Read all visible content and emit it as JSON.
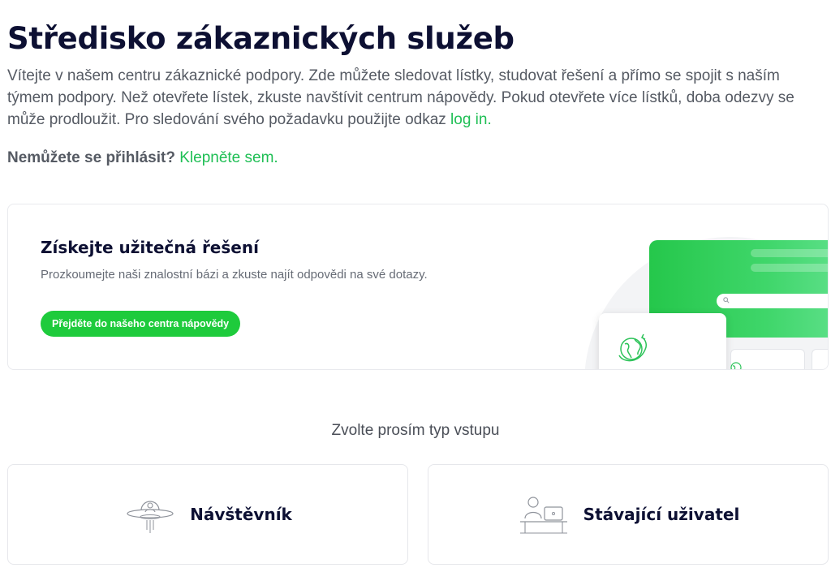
{
  "header": {
    "title": "Středisko zákaznických služeb",
    "intro_text": "Vítejte v našem centru zákaznické podpory. Zde můžete sledovat lístky, studovat řešení a přímo se spojit s naším týmem podpory. Než otevřete lístek, zkuste navštívit centrum nápovědy. Pokud otevřete více lístků, doba odezvy se může prodloužit. Pro sledování svého požadavku použijte odkaz ",
    "login_link": "log in.",
    "cant_login_label": "Nemůžete se přihlásit?",
    "click_here_link": "Klepněte sem."
  },
  "solutions": {
    "title": "Získejte užitečná řešení",
    "description": "Prozkoumejte naši znalostní bázi a zkuste najít odpovědi na své dotazy.",
    "button_label": "Přejděte do našeho centra nápovědy",
    "illustration_icons": [
      "search-icon",
      "globe-icon"
    ]
  },
  "entry_type": {
    "prompt": "Zvolte prosím typ vstupu",
    "options": [
      {
        "label": "Návštěvník",
        "icon": "ufo-visitor-icon"
      },
      {
        "label": "Stávající uživatel",
        "icon": "user-at-desk-icon"
      }
    ]
  },
  "colors": {
    "accent": "#1ecb3c",
    "link": "#1fbf55",
    "title": "#0d1033",
    "body_text": "#555a63"
  }
}
